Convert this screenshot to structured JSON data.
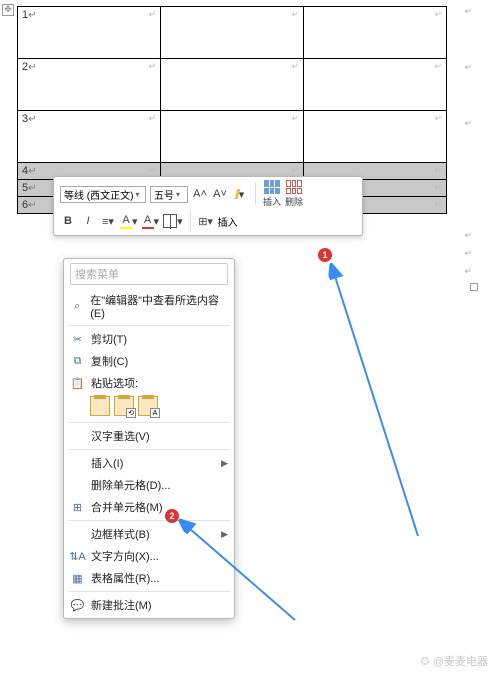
{
  "table": {
    "rows": [
      {
        "num": "1",
        "sel": false,
        "tall": true
      },
      {
        "num": "2",
        "sel": false,
        "tall": true
      },
      {
        "num": "3",
        "sel": false,
        "tall": true
      },
      {
        "num": "4",
        "sel": true,
        "tall": false
      },
      {
        "num": "5",
        "sel": true,
        "tall": false
      },
      {
        "num": "6",
        "sel": true,
        "tall": false
      }
    ],
    "pmark": "↵"
  },
  "toolbar": {
    "font": "等线 (西文正文)",
    "size": "五号",
    "bold": "B",
    "italic": "I",
    "font_color_letter": "A",
    "highlight_letter": "A",
    "insert_label": "插入",
    "delete_label": "删除",
    "size_up": "A˄",
    "size_down": "A˅"
  },
  "menu": {
    "search_placeholder": "搜索菜单",
    "lookup": "在\"编辑器\"中查看所选内容(E)",
    "cut": "剪切(T)",
    "copy": "复制(C)",
    "paste_options": "粘贴选项:",
    "recombine": "汉字重选(V)",
    "insert": "插入(I)",
    "delete_cells": "删除单元格(D)...",
    "merge_cells": "合并单元格(M)",
    "border_style": "边框样式(B)",
    "text_direction": "文字方向(X)...",
    "table_properties": "表格属性(R)...",
    "new_comment": "新建批注(M)"
  },
  "annotations": {
    "badge1": "1",
    "badge2": "2"
  },
  "watermark": "@麦麦电器"
}
